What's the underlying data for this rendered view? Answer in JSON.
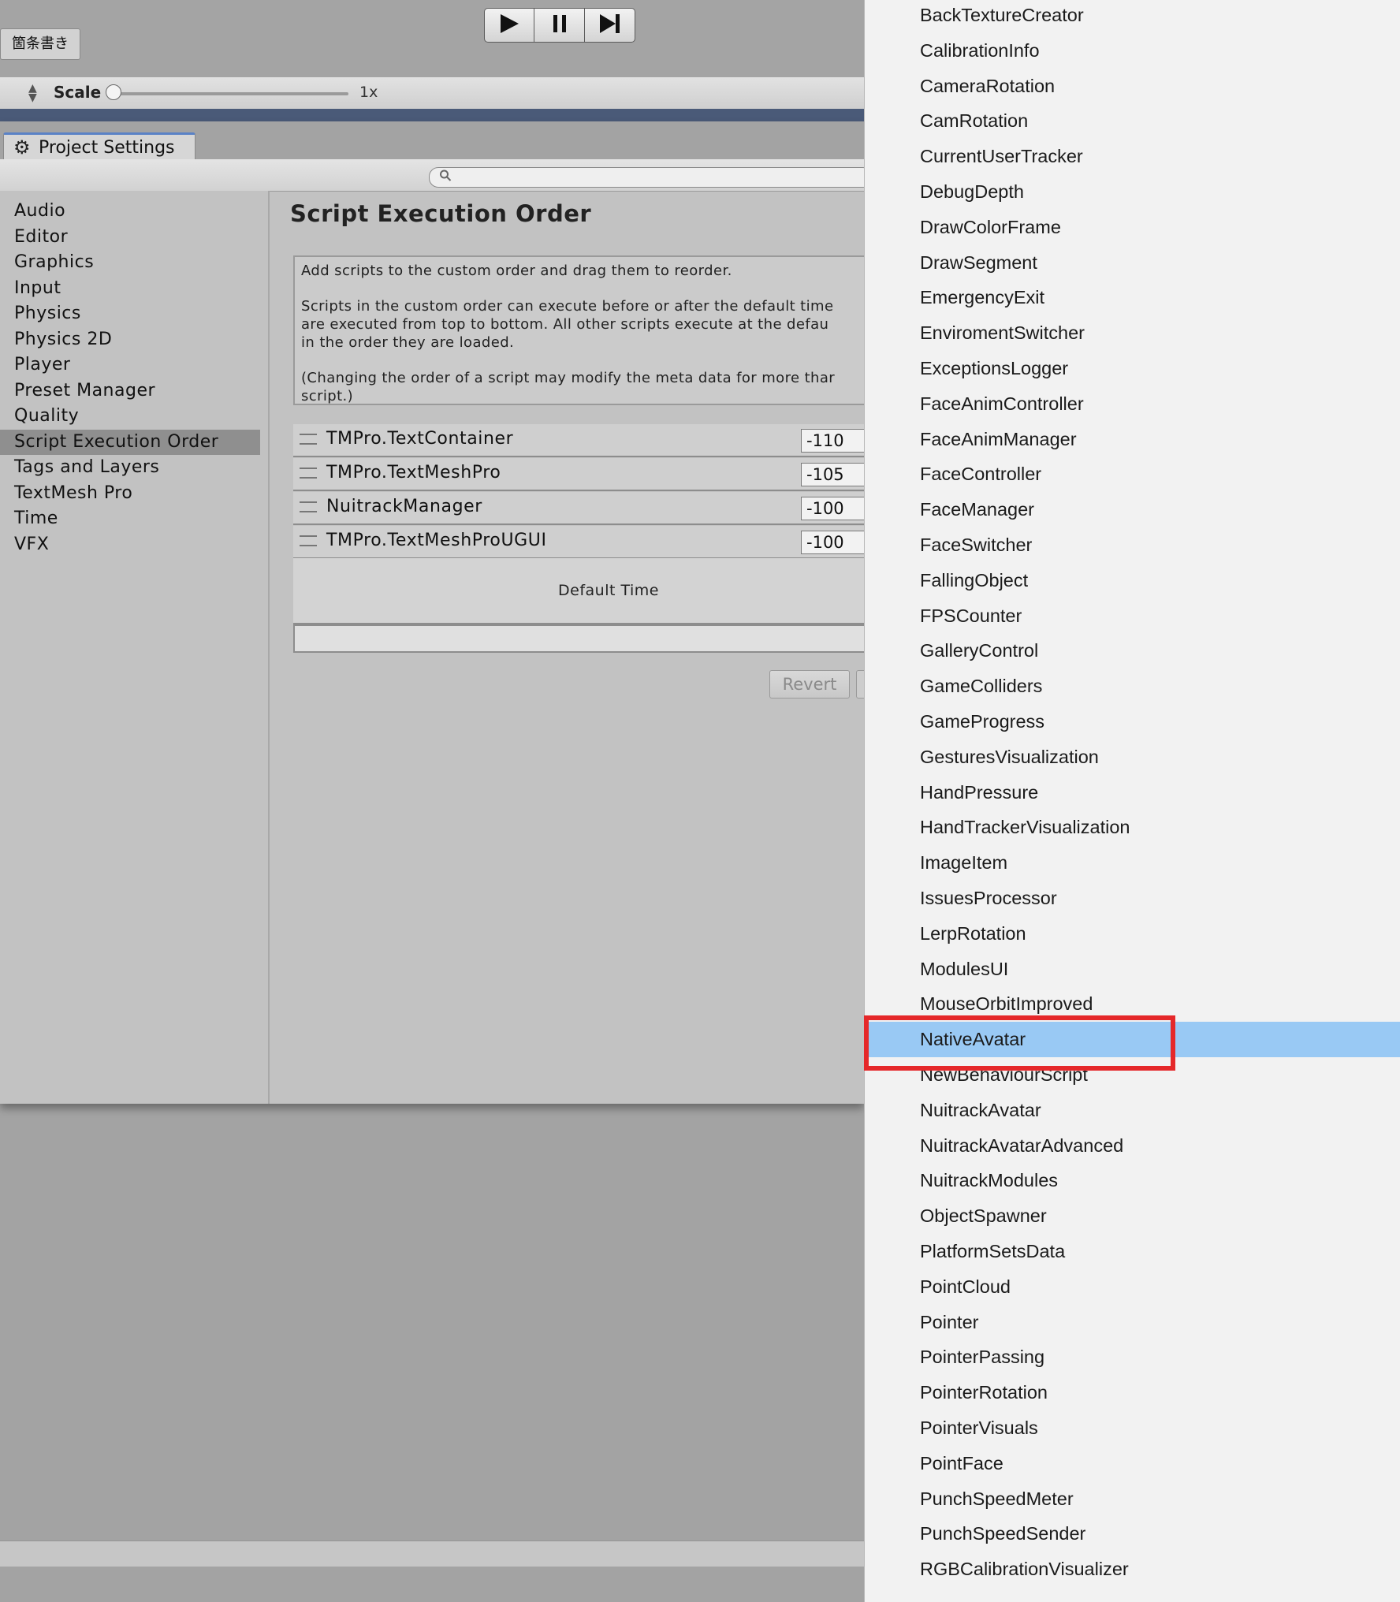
{
  "top_bar": {
    "tab_label": "箇条書き"
  },
  "playback": {
    "play_glyph": "▶",
    "pause_glyph": "❚❚",
    "step_glyph": "▶|"
  },
  "scale_bar": {
    "label": "Scale",
    "value": "1x",
    "slider_level": 0.0
  },
  "project_settings": {
    "tab_label": "Project Settings",
    "search_placeholder": "",
    "sidebar": [
      {
        "label": "Audio",
        "selected": false
      },
      {
        "label": "Editor",
        "selected": false
      },
      {
        "label": "Graphics",
        "selected": false
      },
      {
        "label": "Input",
        "selected": false
      },
      {
        "label": "Physics",
        "selected": false
      },
      {
        "label": "Physics 2D",
        "selected": false
      },
      {
        "label": "Player",
        "selected": false
      },
      {
        "label": "Preset Manager",
        "selected": false
      },
      {
        "label": "Quality",
        "selected": false
      },
      {
        "label": "Script Execution Order",
        "selected": true
      },
      {
        "label": "Tags and Layers",
        "selected": false
      },
      {
        "label": "TextMesh Pro",
        "selected": false
      },
      {
        "label": "Time",
        "selected": false
      },
      {
        "label": "VFX",
        "selected": false
      }
    ],
    "main": {
      "title": "Script Execution Order",
      "help_lines": [
        "Add scripts to the custom order and drag them to reorder.",
        "Scripts in the custom order can execute before or after the default time",
        "are executed from top to bottom. All other scripts execute at the defau",
        "in the order they are loaded.",
        "(Changing the order of a script may modify the meta data for more thar",
        "script.)"
      ],
      "scripts": [
        {
          "name": "TMPro.TextContainer",
          "order": "-110"
        },
        {
          "name": "TMPro.TextMeshPro",
          "order": "-105"
        },
        {
          "name": "NuitrackManager",
          "order": "-100"
        },
        {
          "name": "TMPro.TextMeshProUGUI",
          "order": "-100"
        }
      ],
      "default_time_label": "Default Time",
      "revert_label": "Revert"
    }
  },
  "dropdown": {
    "selected": "NativeAvatar",
    "items": [
      "BackTextureCreator",
      "CalibrationInfo",
      "CameraRotation",
      "CamRotation",
      "CurrentUserTracker",
      "DebugDepth",
      "DrawColorFrame",
      "DrawSegment",
      "EmergencyExit",
      "EnviromentSwitcher",
      "ExceptionsLogger",
      "FaceAnimController",
      "FaceAnimManager",
      "FaceController",
      "FaceManager",
      "FaceSwitcher",
      "FallingObject",
      "FPSCounter",
      "GalleryControl",
      "GameColliders",
      "GameProgress",
      "GesturesVisualization",
      "HandPressure",
      "HandTrackerVisualization",
      "ImageItem",
      "IssuesProcessor",
      "LerpRotation",
      "ModulesUI",
      "MouseOrbitImproved",
      "NativeAvatar",
      "NewBehaviourScript",
      "NuitrackAvatar",
      "NuitrackAvatarAdvanced",
      "NuitrackModules",
      "ObjectSpawner",
      "PlatformSetsData",
      "PointCloud",
      "Pointer",
      "PointerPassing",
      "PointerRotation",
      "PointerVisuals",
      "PointFace",
      "PunchSpeedMeter",
      "PunchSpeedSender",
      "RGBCalibrationVisualizer"
    ]
  },
  "colors": {
    "highlight_row": "#99c9f4",
    "annotation_frame": "#e5282a",
    "selected_sidebar": "#8f8f8f"
  }
}
